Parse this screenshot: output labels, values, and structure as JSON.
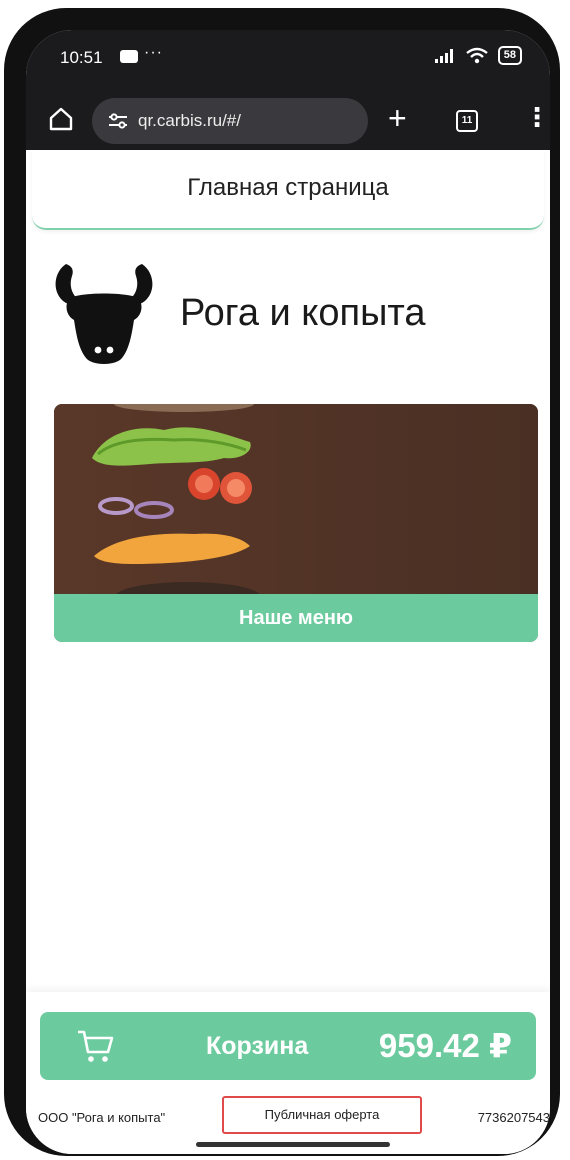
{
  "status_bar": {
    "time": "10:51",
    "dots": "···",
    "battery": "58"
  },
  "browser": {
    "url": "qr.carbis.ru/#/",
    "plus": "+",
    "tab_count": "11",
    "more": "⋮"
  },
  "page": {
    "header_title": "Главная страница",
    "brand_name": "Рога и копыта",
    "menu_button_label": "Наше меню"
  },
  "cart": {
    "label": "Корзина",
    "total": "959.42 ₽"
  },
  "footer": {
    "company": "ООО \"Рога и копыта\"",
    "offer_link": "Публичная оферта",
    "inn": "7736207543"
  },
  "colors": {
    "accent": "#6ccb9e",
    "header_border": "#7fd0ac",
    "browser_bg": "#1b1b1e",
    "offer_border": "#e04a4a"
  },
  "icons": [
    "home-icon",
    "site-settings-icon",
    "plus-icon",
    "tabs-icon",
    "more-icon",
    "bull-logo-icon",
    "cart-icon",
    "signal-icon",
    "wifi-icon",
    "battery-icon"
  ]
}
